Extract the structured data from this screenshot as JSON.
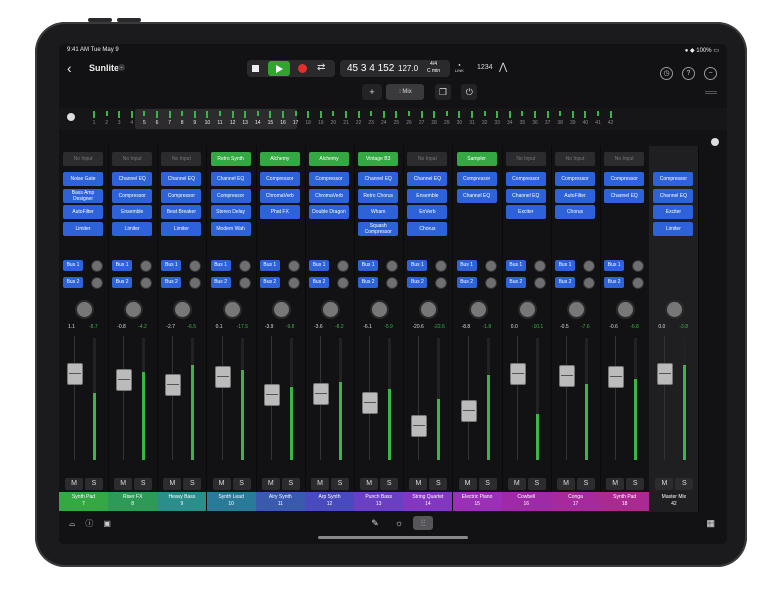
{
  "status": {
    "time": "9:41 AM  Tue May 9",
    "battery": "100%"
  },
  "toolbar": {
    "title": "Sunlite",
    "position": "45 3 4 152",
    "tempo": "127.0",
    "signature": "4/4",
    "key": "C min",
    "link_label": "LINK",
    "count_in": "1234",
    "tuner_icon": "tuning-fork-icon",
    "mix_label": "Mix"
  },
  "ruler": {
    "numbers": [
      "1",
      "2",
      "3",
      "4",
      "5",
      "6",
      "7",
      "8",
      "9",
      "10",
      "11",
      "12",
      "13",
      "14",
      "15",
      "16",
      "17",
      "18",
      "19",
      "20",
      "21",
      "22",
      "23",
      "24",
      "25",
      "26",
      "27",
      "28",
      "29",
      "30",
      "31",
      "32",
      "33",
      "34",
      "35",
      "36",
      "37",
      "38",
      "39",
      "40",
      "41",
      "42"
    ]
  },
  "colors": {
    "accent_blue": "#2d62d8",
    "play_green": "#2fa52f",
    "record_red": "#e0302a",
    "meter_green": "#39b54a"
  },
  "channels": [
    {
      "name": "Synth Pad",
      "num": "7",
      "color": "#34a843",
      "input": "No Input",
      "input_green": false,
      "plugins": [
        "Noise Gate",
        "Bass Amp Designer",
        "AutoFilter",
        "Limiter"
      ],
      "vol": "1.1",
      "peak": "-8.7",
      "fader": 0.62,
      "meter": 0.55
    },
    {
      "name": "Riser FX",
      "num": "8",
      "color": "#2e9a58",
      "input": "No Input",
      "input_green": false,
      "plugins": [
        "Channel EQ",
        "Compressor",
        "Ensemble",
        "Limiter"
      ],
      "vol": "-0.8",
      "peak": "-4.2",
      "fader": 0.7,
      "meter": 0.72
    },
    {
      "name": "Heavy Bass",
      "num": "9",
      "color": "#2a8f8a",
      "input": "No Input",
      "input_green": false,
      "plugins": [
        "Channel EQ",
        "Compressor",
        "Beat Breaker",
        "Limiter"
      ],
      "vol": "-2.7",
      "peak": "-6.5",
      "fader": 0.76,
      "meter": 0.78
    },
    {
      "name": "Synth Lead",
      "num": "10",
      "color": "#2a7a99",
      "input": "Retro Synth",
      "input_green": true,
      "plugins": [
        "Channel EQ",
        "Compressor",
        "Stereo Delay",
        "Modern Wah"
      ],
      "vol": "0.1",
      "peak": "-17.5",
      "fader": 0.66,
      "meter": 0.74
    },
    {
      "name": "Airy Synth",
      "num": "11",
      "color": "#3a5ab0",
      "input": "Alchemy",
      "input_green": true,
      "plugins": [
        "Compressor",
        "ChromaVerb",
        "Phat FX"
      ],
      "vol": "-3.9",
      "peak": "-9.8",
      "fader": 0.9,
      "meter": 0.6
    },
    {
      "name": "Arp Synth",
      "num": "12",
      "color": "#4a4ac0",
      "input": "Alchemy",
      "input_green": true,
      "plugins": [
        "Compressor",
        "ChromaVerb",
        "Double Dragon"
      ],
      "vol": "-3.6",
      "peak": "-8.2",
      "fader": 0.88,
      "meter": 0.64
    },
    {
      "name": "Punch Bass",
      "num": "13",
      "color": "#6b3fc4",
      "input": "Vintage B3",
      "input_green": true,
      "plugins": [
        "Channel EQ",
        "Retro Chorus",
        "Wham",
        "Squash Compressor"
      ],
      "vol": "-6.1",
      "peak": "-5.9",
      "fader": 1.0,
      "meter": 0.58
    },
    {
      "name": "String Quartet",
      "num": "14",
      "color": "#8236c2",
      "input": "No Input",
      "input_green": false,
      "plugins": [
        "Channel EQ",
        "Ensemble",
        "EnVerb",
        "Chorus"
      ],
      "vol": "-20.6",
      "peak": "-22.6",
      "fader": 1.3,
      "meter": 0.5
    },
    {
      "name": "Electric Piano",
      "num": "15",
      "color": "#9a2fb8",
      "input": "Sampler",
      "input_green": true,
      "plugins": [
        "Compressor",
        "Channel EQ"
      ],
      "vol": "-8.8",
      "peak": "-1.8",
      "fader": 1.1,
      "meter": 0.7
    },
    {
      "name": "Cowbell",
      "num": "16",
      "color": "#9f2aa8",
      "input": "No Input",
      "input_green": false,
      "plugins": [
        "Compressor",
        "Channel EQ",
        "Exciter"
      ],
      "vol": "0.0",
      "peak": "-10.1",
      "fader": 0.62,
      "meter": 0.38
    },
    {
      "name": "Conga",
      "num": "17",
      "color": "#a62a9c",
      "input": "No Input",
      "input_green": false,
      "plugins": [
        "Compressor",
        "AutoFilter",
        "Chorus"
      ],
      "vol": "-0.5",
      "peak": "-7.6",
      "fader": 0.64,
      "meter": 0.62
    },
    {
      "name": "Synth Pad",
      "num": "18",
      "color": "#ab2a92",
      "input": "No Input",
      "input_green": false,
      "plugins": [
        "Compressor",
        "Channel EQ"
      ],
      "vol": "-0.6",
      "peak": "-6.8",
      "fader": 0.66,
      "meter": 0.66
    },
    {
      "name": "Master Mix",
      "num": "42",
      "color": "#1f1f22",
      "input": "",
      "input_green": false,
      "plugins": [
        "Compressor",
        "Channel EQ",
        "Exciter",
        "Limiter"
      ],
      "vol": "0.0",
      "peak": "-3.8",
      "fader": 0.62,
      "meter": 0.78,
      "master": true
    }
  ],
  "sends": {
    "bus1": "Bus 1",
    "bus2": "Bus 2"
  },
  "buttons": {
    "mute": "M",
    "solo": "S"
  }
}
